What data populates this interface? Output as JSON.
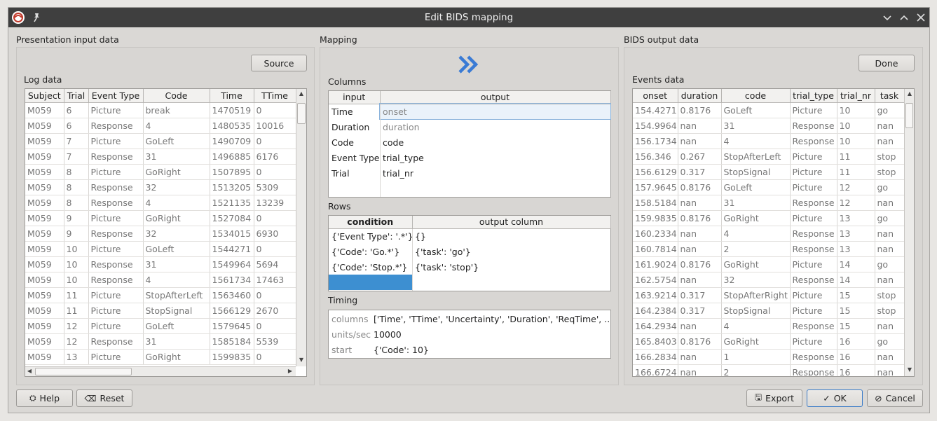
{
  "window": {
    "title": "Edit BIDS mapping",
    "min_icon": "chevron-down-icon",
    "max_icon": "chevron-up-icon",
    "close_icon": "close-icon"
  },
  "left": {
    "section_title": "Presentation input data",
    "source_button": "Source",
    "log_label": "Log data",
    "columns": [
      "Subject",
      "Trial",
      "Event Type",
      "Code",
      "Time",
      "TTime"
    ],
    "rows": [
      [
        "M059",
        "6",
        "Picture",
        "break",
        "1470519",
        "0"
      ],
      [
        "M059",
        "6",
        "Response",
        "4",
        "1480535",
        "10016"
      ],
      [
        "M059",
        "7",
        "Picture",
        "GoLeft",
        "1490709",
        "0"
      ],
      [
        "M059",
        "7",
        "Response",
        "31",
        "1496885",
        "6176"
      ],
      [
        "M059",
        "8",
        "Picture",
        "GoRight",
        "1507895",
        "0"
      ],
      [
        "M059",
        "8",
        "Response",
        "32",
        "1513205",
        "5309"
      ],
      [
        "M059",
        "8",
        "Response",
        "4",
        "1521135",
        "13239"
      ],
      [
        "M059",
        "9",
        "Picture",
        "GoRight",
        "1527084",
        "0"
      ],
      [
        "M059",
        "9",
        "Response",
        "32",
        "1534015",
        "6930"
      ],
      [
        "M059",
        "10",
        "Picture",
        "GoLeft",
        "1544271",
        "0"
      ],
      [
        "M059",
        "10",
        "Response",
        "31",
        "1549964",
        "5694"
      ],
      [
        "M059",
        "10",
        "Response",
        "4",
        "1561734",
        "17463"
      ],
      [
        "M059",
        "11",
        "Picture",
        "StopAfterLeft",
        "1563460",
        "0"
      ],
      [
        "M059",
        "11",
        "Picture",
        "StopSignal",
        "1566129",
        "2670"
      ],
      [
        "M059",
        "12",
        "Picture",
        "GoLeft",
        "1579645",
        "0"
      ],
      [
        "M059",
        "12",
        "Response",
        "31",
        "1585184",
        "5539"
      ],
      [
        "M059",
        "13",
        "Picture",
        "GoRight",
        "1599835",
        "0"
      ]
    ]
  },
  "mapping": {
    "section_title": "Mapping",
    "columns_label": "Columns",
    "columns_headers": [
      "input",
      "output"
    ],
    "columns_rows": [
      [
        "Time",
        "onset"
      ],
      [
        "Duration",
        "duration"
      ],
      [
        "Code",
        "code"
      ],
      [
        "Event Type",
        "trial_type"
      ],
      [
        "Trial",
        "trial_nr"
      ]
    ],
    "rows_label": "Rows",
    "rows_headers": [
      "condition",
      "output column"
    ],
    "rows_rows": [
      [
        "{'Event Type': '.*'}",
        "{}"
      ],
      [
        "{'Code': 'Go.*'}",
        "{'task': 'go'}"
      ],
      [
        "{'Code': 'Stop.*'}",
        "{'task': 'stop'}"
      ]
    ],
    "timing_label": "Timing",
    "timing_rows": [
      [
        "columns",
        "['Time', 'TTime', 'Uncertainty', 'Duration', 'ReqTime', ..."
      ],
      [
        "units/sec",
        "10000"
      ],
      [
        "start",
        "{'Code': 10}"
      ]
    ]
  },
  "right": {
    "section_title": "BIDS output data",
    "done_button": "Done",
    "events_label": "Events data",
    "columns": [
      "onset",
      "duration",
      "code",
      "trial_type",
      "trial_nr",
      "task"
    ],
    "rows": [
      [
        "154.4271",
        "0.8176",
        "GoLeft",
        "Picture",
        "10",
        "go"
      ],
      [
        "154.9964",
        "nan",
        "31",
        "Response",
        "10",
        "nan"
      ],
      [
        "156.1734",
        "nan",
        "4",
        "Response",
        "10",
        "nan"
      ],
      [
        "156.346",
        "0.267",
        "StopAfterLeft",
        "Picture",
        "11",
        "stop"
      ],
      [
        "156.6129",
        "0.317",
        "StopSignal",
        "Picture",
        "11",
        "stop"
      ],
      [
        "157.9645",
        "0.8176",
        "GoLeft",
        "Picture",
        "12",
        "go"
      ],
      [
        "158.5184",
        "nan",
        "31",
        "Response",
        "12",
        "nan"
      ],
      [
        "159.9835",
        "0.8176",
        "GoRight",
        "Picture",
        "13",
        "go"
      ],
      [
        "160.2334",
        "nan",
        "4",
        "Response",
        "13",
        "nan"
      ],
      [
        "160.7814",
        "nan",
        "2",
        "Response",
        "13",
        "nan"
      ],
      [
        "161.9024",
        "0.8176",
        "GoRight",
        "Picture",
        "14",
        "go"
      ],
      [
        "162.5754",
        "nan",
        "32",
        "Response",
        "14",
        "nan"
      ],
      [
        "163.9214",
        "0.317",
        "StopAfterRight",
        "Picture",
        "15",
        "stop"
      ],
      [
        "164.2384",
        "0.317",
        "StopSignal",
        "Picture",
        "15",
        "stop"
      ],
      [
        "164.2934",
        "nan",
        "4",
        "Response",
        "15",
        "nan"
      ],
      [
        "165.8403",
        "0.8176",
        "GoRight",
        "Picture",
        "16",
        "go"
      ],
      [
        "166.2834",
        "nan",
        "1",
        "Response",
        "16",
        "nan"
      ],
      [
        "166.6724",
        "nan",
        "2",
        "Response",
        "16",
        "nan"
      ]
    ]
  },
  "footer": {
    "help": "Help",
    "reset": "Reset",
    "export": "Export",
    "ok": "OK",
    "cancel": "Cancel"
  },
  "colors": {
    "selection": "#3d8fd1",
    "accent": "#3a7bd5"
  }
}
